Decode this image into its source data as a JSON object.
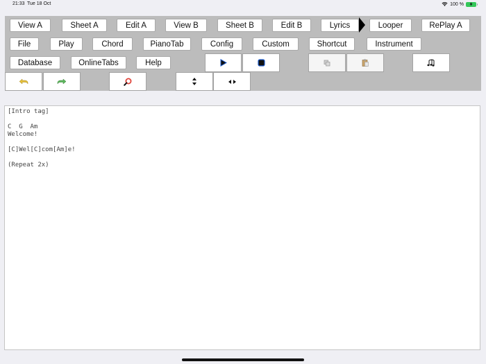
{
  "status": {
    "time": "21:33",
    "date": "Tue 18 Oct",
    "battery": "100 %"
  },
  "toolbar": {
    "row1": [
      "View A",
      "Sheet A",
      "Edit A",
      "View B",
      "Sheet B",
      "Edit B",
      "Lyrics",
      "Looper",
      "RePlay A"
    ],
    "row2": [
      "File",
      "Play",
      "Chord",
      "PianoTab",
      "Config",
      "Custom",
      "Shortcut",
      "Instrument"
    ],
    "row3": [
      "Database",
      "OnlineTabs",
      "Help"
    ]
  },
  "icons": {
    "play": "play-icon",
    "stop": "stop-icon",
    "copy": "copy-icon",
    "paste": "paste-icon",
    "notes": "music-notes-icon",
    "undo": "undo-icon",
    "redo": "redo-icon",
    "search": "search-icon",
    "vertical": "vertical-resize-icon",
    "horizontal": "horizontal-resize-icon"
  },
  "colors": {
    "toolbar_bg": "#bcbcbc",
    "undo": "#e6c13a",
    "redo": "#5cb85c",
    "search_accent": "#e0443a",
    "battery": "#34c759"
  },
  "editor": {
    "content": "[Intro tag]\n\nC  G  Am\nWelcome!\n\n[C]Wel[C]com[Am]e!\n\n(Repeat 2x)"
  }
}
